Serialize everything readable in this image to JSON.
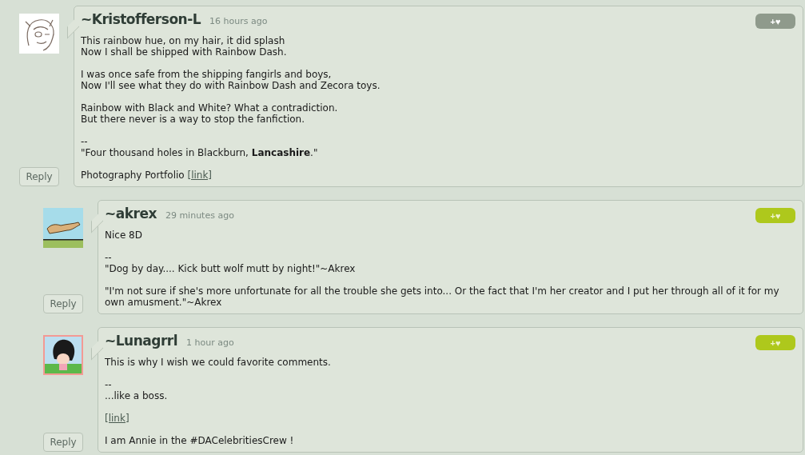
{
  "comments": [
    {
      "author": "~Kristofferson-L",
      "time": "16 hours ago",
      "kind": "sketch",
      "fav": {
        "label": "+♥",
        "active": false
      },
      "reply": "Reply",
      "paragraphs": [
        {
          "text": "This rainbow hue, on my hair, it did splash\nNow I shall be shipped with Rainbow Dash."
        },
        {
          "text": "I was once safe from the shipping fangirls and boys,\nNow I'll see what they do with Rainbow Dash and Zecora toys."
        },
        {
          "text": "Rainbow with Black and White? What a contradiction.\nBut there never is a way to stop the fanfiction."
        },
        {
          "text": "--\n\"Four thousand holes in Blackburn, **Lancashire**.\""
        },
        {
          "text": "Photography Portfolio ",
          "link": "[link]"
        }
      ],
      "children": [
        {
          "author": "~akrex",
          "time": "29 minutes ago",
          "kind": "dog",
          "fav": {
            "label": "+♥",
            "active": true
          },
          "reply": "Reply",
          "paragraphs": [
            {
              "text": "Nice 8D"
            },
            {
              "text": "--\n\"Dog by day.... Kick butt wolf mutt by night!\"~Akrex"
            },
            {
              "text": "\"I'm not sure if she's more unfortunate for all the trouble she gets into... Or the fact that I'm her creator and I put her through all of it for my own amusment.\"~Akrex"
            }
          ]
        },
        {
          "author": "~Lunagrrl",
          "time": "1 hour ago",
          "kind": "girl",
          "fav": {
            "label": "+♥",
            "active": true
          },
          "reply": "Reply",
          "paragraphs": [
            {
              "text": "This is why I wish we could favorite comments."
            },
            {
              "text": "--\n...like a boss."
            },
            {
              "link": "[link]"
            },
            {
              "text": "I am Annie in the #DACelebritiesCrew !"
            }
          ]
        }
      ]
    }
  ]
}
